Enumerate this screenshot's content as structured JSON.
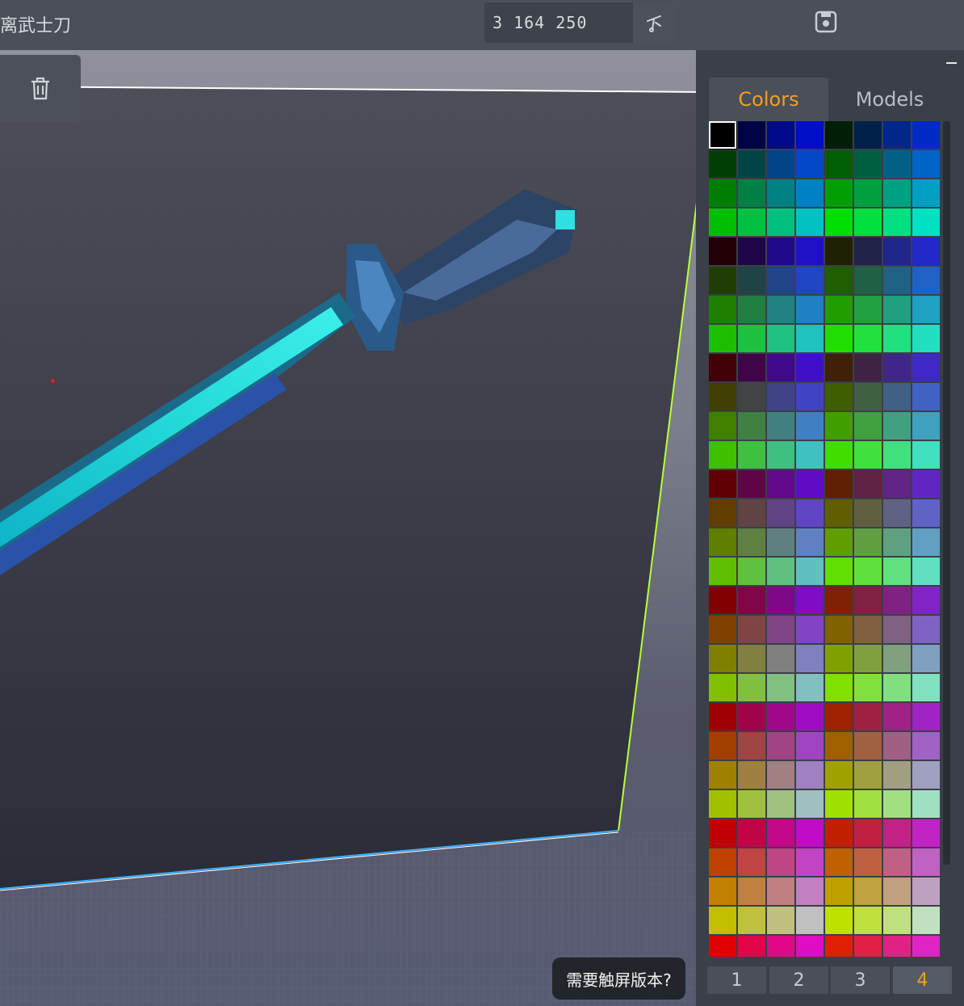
{
  "topbar": {
    "title": "离武士刀",
    "coords_value": "3 164 250"
  },
  "viewport": {
    "touch_prompt": "需要触屏版本?"
  },
  "panel": {
    "tabs": [
      {
        "label": "Colors",
        "active": true
      },
      {
        "label": "Models",
        "active": false
      }
    ],
    "pages": [
      {
        "label": "1",
        "active": false
      },
      {
        "label": "2",
        "active": false
      },
      {
        "label": "3",
        "active": false
      },
      {
        "label": "4",
        "active": true
      }
    ],
    "selected_color": "#000000",
    "accent_color": "#f0a020",
    "palette": [
      [
        "#000000",
        "#000446",
        "#000a8a",
        "#000ec8",
        "#001f06",
        "#00214a",
        "#00278a",
        "#002ac8"
      ],
      [
        "#003e06",
        "#004448",
        "#004488",
        "#0048c8",
        "#005e04",
        "#006044",
        "#006186",
        "#0064c6"
      ],
      [
        "#007e04",
        "#008044",
        "#008082",
        "#0081c4",
        "#009e02",
        "#00a040",
        "#00a082",
        "#00a0c4"
      ],
      [
        "#00be02",
        "#00c040",
        "#00c080",
        "#00c2c2",
        "#00de00",
        "#00e040",
        "#00e080",
        "#00e0c2"
      ],
      [
        "#200006",
        "#200448",
        "#20088a",
        "#2010c8",
        "#202004",
        "#202248",
        "#20268a",
        "#2028c8"
      ],
      [
        "#203e04",
        "#204446",
        "#204488",
        "#2046c6",
        "#205e02",
        "#206044",
        "#206284",
        "#2062c4"
      ],
      [
        "#207e00",
        "#208042",
        "#208082",
        "#2080c4",
        "#209e00",
        "#20a040",
        "#20a080",
        "#20a0c2"
      ],
      [
        "#20be00",
        "#20c040",
        "#20c080",
        "#20c2c0",
        "#20de00",
        "#20e03e",
        "#20e080",
        "#20e0c0"
      ],
      [
        "#400006",
        "#400448",
        "#40088a",
        "#4010c8",
        "#402006",
        "#402244",
        "#402688",
        "#4028c6"
      ],
      [
        "#403e02",
        "#404444",
        "#404486",
        "#4044c4",
        "#405e02",
        "#406044",
        "#406084",
        "#4062c4"
      ],
      [
        "#407e00",
        "#408042",
        "#408080",
        "#4080c2",
        "#409e00",
        "#40a040",
        "#40a080",
        "#40a0c0"
      ],
      [
        "#40be00",
        "#40c040",
        "#40c080",
        "#40c0c0",
        "#40de00",
        "#40e03e",
        "#40e07e",
        "#40e0c0"
      ],
      [
        "#600004",
        "#600448",
        "#600888",
        "#600cc6",
        "#602004",
        "#602244",
        "#602486",
        "#6026c4"
      ],
      [
        "#603e00",
        "#604444",
        "#604486",
        "#6046c4",
        "#605e00",
        "#606040",
        "#606284",
        "#6062c4"
      ],
      [
        "#607e00",
        "#608042",
        "#608080",
        "#6080c2",
        "#609e00",
        "#60a040",
        "#60a080",
        "#60a0c2"
      ],
      [
        "#60be00",
        "#60c040",
        "#60c080",
        "#60c0c0",
        "#60de00",
        "#60e03e",
        "#60e07e",
        "#60e0c0"
      ],
      [
        "#800004",
        "#800446",
        "#800888",
        "#800cc6",
        "#802004",
        "#802044",
        "#802284",
        "#8024c4"
      ],
      [
        "#804000",
        "#804444",
        "#804486",
        "#8044c4",
        "#806000",
        "#806040",
        "#806084",
        "#8062c4"
      ],
      [
        "#808000",
        "#808040",
        "#808080",
        "#8080c0",
        "#80a000",
        "#80a040",
        "#80a080",
        "#80a0c0"
      ],
      [
        "#80c000",
        "#80c040",
        "#80c080",
        "#80c0c0",
        "#80e000",
        "#80e040",
        "#80e080",
        "#80e0c0"
      ],
      [
        "#a00004",
        "#a00448",
        "#a00888",
        "#a00cc6",
        "#a02002",
        "#a02044",
        "#a02286",
        "#a024c4"
      ],
      [
        "#a04000",
        "#a04444",
        "#a04486",
        "#a044c4",
        "#a06000",
        "#a06042",
        "#a06084",
        "#a062c4"
      ],
      [
        "#a08000",
        "#a08042",
        "#a08082",
        "#a080c2",
        "#a0a000",
        "#a0a040",
        "#a0a080",
        "#a0a0c0"
      ],
      [
        "#a0c000",
        "#a0c040",
        "#a0c080",
        "#a0c0c0",
        "#a0e000",
        "#a0e040",
        "#a0e080",
        "#a0e0c0"
      ],
      [
        "#c00004",
        "#c00448",
        "#c00888",
        "#c00cc6",
        "#c02002",
        "#c02044",
        "#c02286",
        "#c024c4"
      ],
      [
        "#c04000",
        "#c04444",
        "#c04486",
        "#c044c4",
        "#c06000",
        "#c06042",
        "#c06084",
        "#c062c4"
      ],
      [
        "#c08000",
        "#c08042",
        "#c08082",
        "#c080c2",
        "#c0a000",
        "#c0a040",
        "#c0a080",
        "#c0a0c0"
      ],
      [
        "#c0c000",
        "#c0c040",
        "#c0c080",
        "#c0c0c0",
        "#c0e000",
        "#c0e040",
        "#c0e080",
        "#c0e0c0"
      ],
      [
        "#e00004",
        "#e00448",
        "#e00888",
        "#e00cc6",
        "#e02002",
        "#e02044",
        "#e02286",
        "#e024c4"
      ]
    ]
  }
}
